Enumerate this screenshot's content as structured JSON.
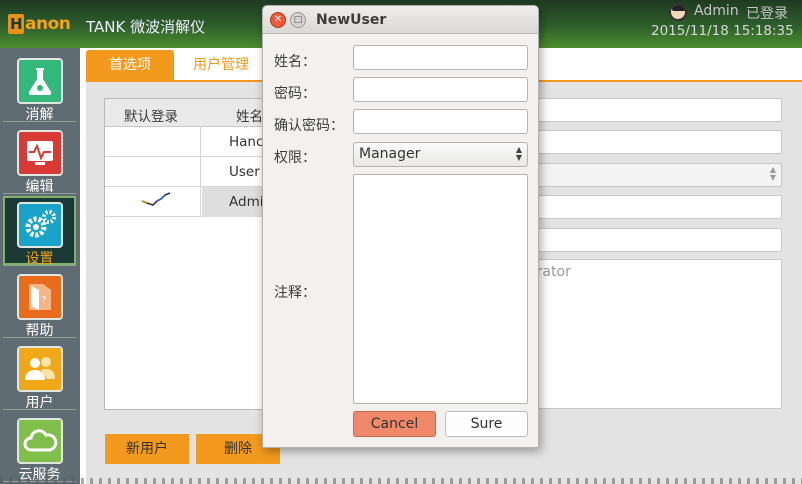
{
  "app": {
    "logo_text": "anon",
    "logo_mark": "H",
    "title": "TANK 微波消解仪",
    "user": "Admin",
    "login_state": "已登录",
    "datetime": "2015/11/18 15:18:35"
  },
  "sidebar": {
    "items": [
      {
        "label": "消解",
        "icon": "flask-icon",
        "color": "#34b77b"
      },
      {
        "label": "编辑",
        "icon": "monitor-chart-icon",
        "color": "#d93a36"
      },
      {
        "label": "设置",
        "icon": "gears-icon",
        "color": "#1aa3c8"
      },
      {
        "label": "帮助",
        "icon": "help-book-icon",
        "color": "#e86c1c"
      },
      {
        "label": "用户",
        "icon": "users-icon",
        "color": "#f0a818"
      },
      {
        "label": "云服务",
        "icon": "cloud-icon",
        "color": "#7fbf4a"
      }
    ]
  },
  "tabs": [
    {
      "label": "首选项"
    },
    {
      "label": "用户管理"
    }
  ],
  "table": {
    "headers": [
      "默认登录",
      "姓名"
    ],
    "rows": [
      {
        "name": "Hanc"
      },
      {
        "name": "User"
      },
      {
        "name": "Admi"
      }
    ]
  },
  "details": {
    "note_value": "istrator"
  },
  "buttons": {
    "new_user": "新用户",
    "delete": "删除"
  },
  "dialog": {
    "title": "NewUser",
    "labels": {
      "name": "姓名：",
      "password": "密码：",
      "confirm": "确认密码：",
      "permission": "权限：",
      "note": "注释："
    },
    "permission_value": "Manager",
    "cancel": "Cancel",
    "sure": "Sure"
  },
  "colors": {
    "accent": "#f39a1e",
    "header": "#2e5f2c"
  }
}
